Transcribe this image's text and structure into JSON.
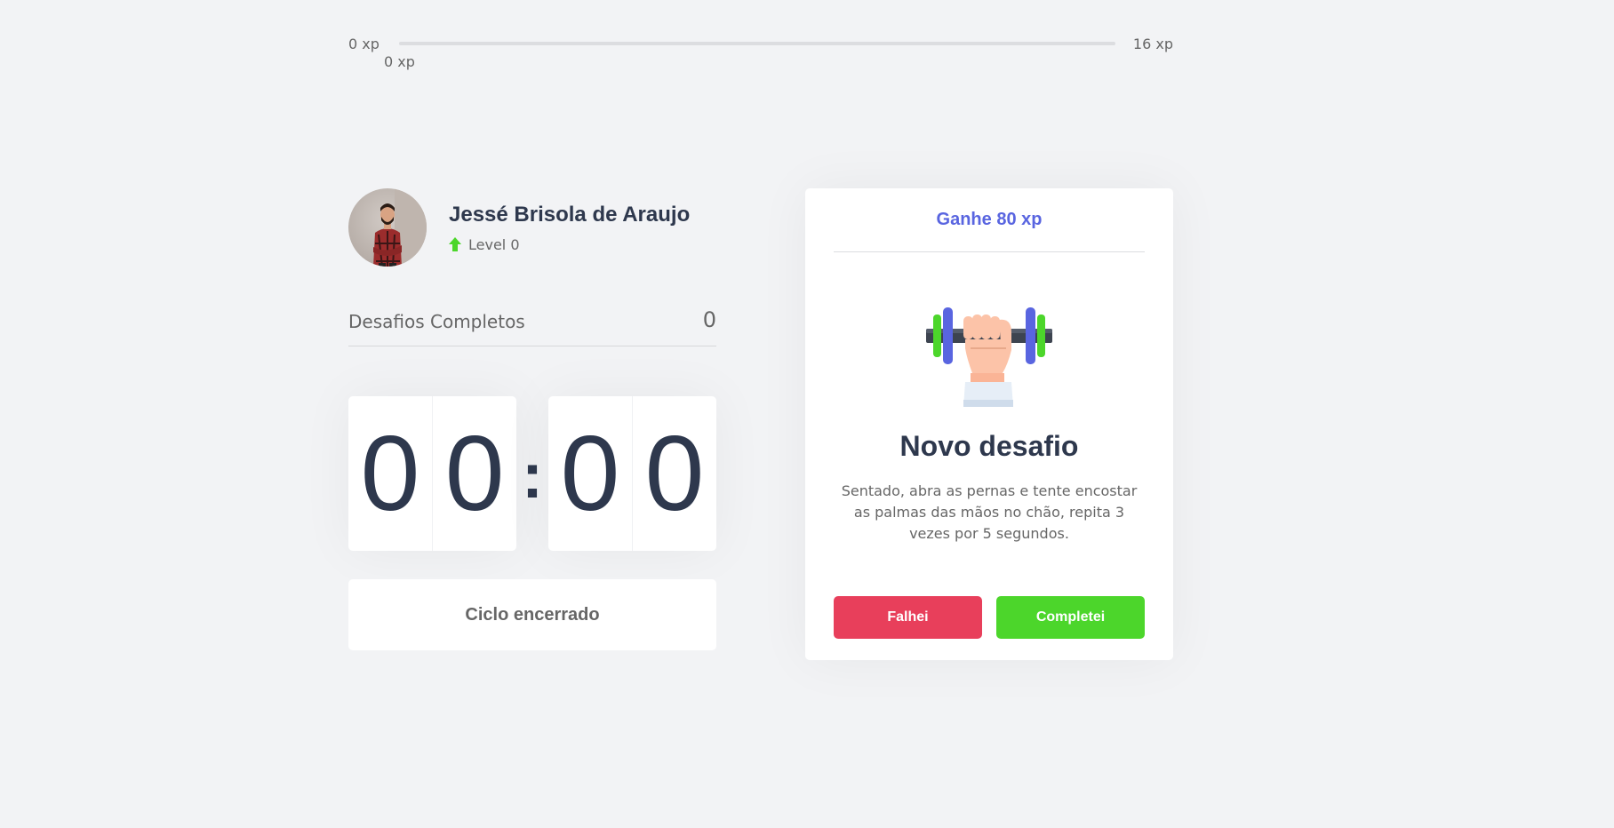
{
  "xp": {
    "min_label": "0 xp",
    "max_label": "16 xp",
    "current_label": "0 xp",
    "progress_percent": 0,
    "fill_color": "#4cd62b"
  },
  "profile": {
    "name": "Jessé Brisola de Araujo",
    "level_label": "Level 0",
    "level_icon": "level-up-arrow-icon"
  },
  "completed": {
    "label": "Desafios Completos",
    "count": "0"
  },
  "countdown": {
    "minute_left": "0",
    "minute_right": "0",
    "separator": ":",
    "second_left": "0",
    "second_right": "0"
  },
  "cycle_button": {
    "label": "Ciclo encerrado"
  },
  "challenge": {
    "header": "Ganhe 80 xp",
    "icon": "dumbbell-icon",
    "title": "Novo desafio",
    "description": "Sentado, abra as pernas e tente encostar as palmas das mãos no chão, repita 3 vezes por 5 segundos.",
    "fail_label": "Falhei",
    "success_label": "Completei"
  },
  "colors": {
    "background": "#f2f3f5",
    "text": "#666666",
    "title": "#2e384d",
    "blue": "#5965e0",
    "red": "#e83f5b",
    "green": "#4cd62b"
  }
}
